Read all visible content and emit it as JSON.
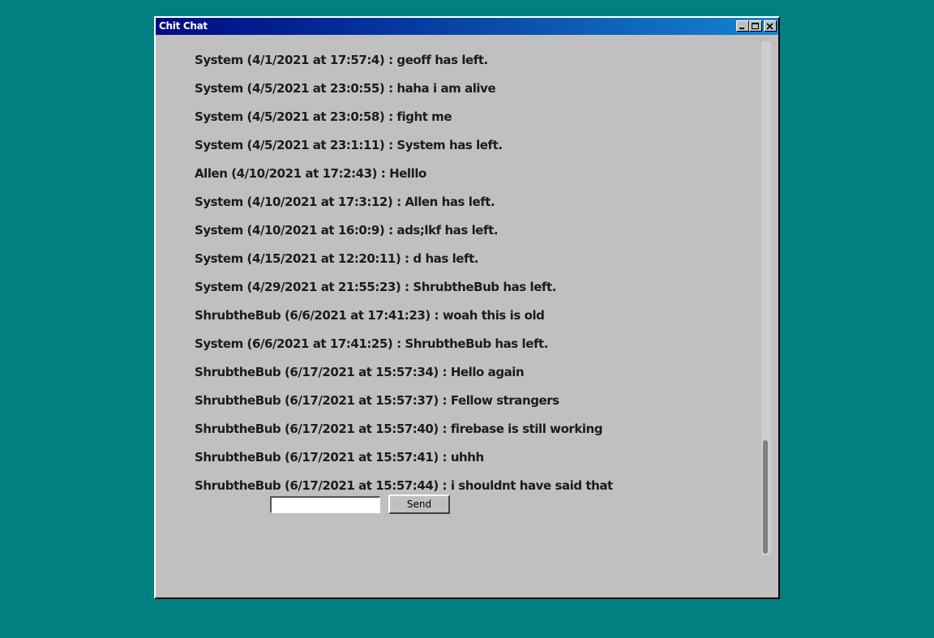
{
  "window": {
    "title": "Chit Chat"
  },
  "messages": [
    "System (4/1/2021 at 17:57:4) : geoff has left.",
    "System (4/5/2021 at 23:0:55) : haha i am alive",
    "System (4/5/2021 at 23:0:58) : fight me",
    "System (4/5/2021 at 23:1:11) : System has left.",
    "Allen (4/10/2021 at 17:2:43) : Helllo",
    "System (4/10/2021 at 17:3:12) : Allen has left.",
    "System (4/10/2021 at 16:0:9) : ads;lkf has left.",
    "System (4/15/2021 at 12:20:11) : d has left.",
    "System (4/29/2021 at 21:55:23) : ShrubtheBub has left.",
    "ShrubtheBub (6/6/2021 at 17:41:23) : woah this is old",
    "System (6/6/2021 at 17:41:25) : ShrubtheBub has left.",
    "ShrubtheBub (6/17/2021 at 15:57:34) : Hello again",
    "ShrubtheBub (6/17/2021 at 15:57:37) : Fellow strangers",
    "ShrubtheBub (6/17/2021 at 15:57:40) : firebase is still working",
    "ShrubtheBub (6/17/2021 at 15:57:41) : uhhh",
    "ShrubtheBub (6/17/2021 at 15:57:44) : i shouldnt have said that"
  ],
  "composer": {
    "input_value": "",
    "send_label": "Send"
  },
  "icons": {
    "minimize": "minimize-icon",
    "maximize": "maximize-icon",
    "close": "close-icon"
  },
  "colors": {
    "desktop": "#008080",
    "window_bg": "#c0c0c0",
    "titlebar_start": "#000a87",
    "titlebar_end": "#1484d0",
    "text": "#1c1c1c"
  }
}
